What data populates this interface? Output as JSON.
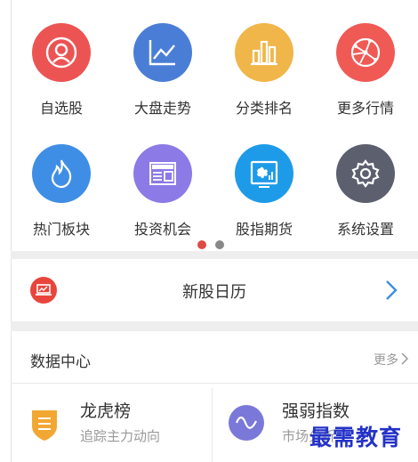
{
  "grid": {
    "items": [
      {
        "label": "自选股",
        "color": "#ec5454"
      },
      {
        "label": "大盘走势",
        "color": "#4a7ed6"
      },
      {
        "label": "分类排名",
        "color": "#f0b64a"
      },
      {
        "label": "更多行情",
        "color": "#f05a55"
      },
      {
        "label": "热门板块",
        "color": "#3f8ee6"
      },
      {
        "label": "投资机会",
        "color": "#8c7ae6"
      },
      {
        "label": "股指期货",
        "color": "#1e9be8"
      },
      {
        "label": "系统设置",
        "color": "#5c5f6e"
      }
    ]
  },
  "pager": {
    "active_color": "#e04a44",
    "inactive_color": "#888888"
  },
  "ipo": {
    "title": "新股日历"
  },
  "data_center": {
    "title": "数据中心",
    "more_label": "更多"
  },
  "cards": [
    {
      "title": "龙虎榜",
      "subtitle": "追踪主力动向",
      "icon_color": "#f2a733"
    },
    {
      "title": "强弱指数",
      "subtitle": "市场分析",
      "icon_color": "#7a78d8"
    }
  ],
  "watermark": "最需教育"
}
